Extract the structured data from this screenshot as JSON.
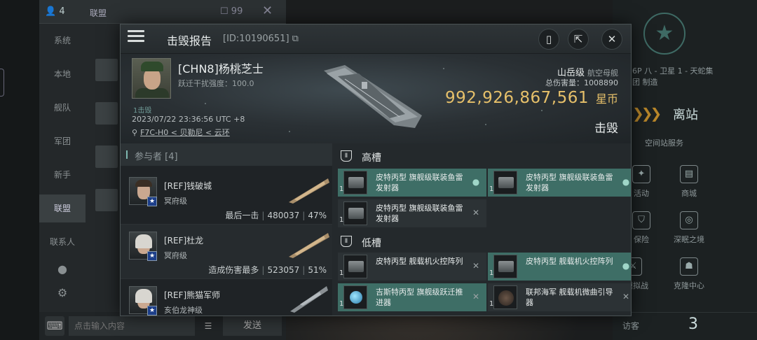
{
  "background": {
    "chat": {
      "member_count": "4",
      "channel_name": "联盟",
      "unread_count": "99",
      "channels": [
        "系统",
        "本地",
        "舰队",
        "军团",
        "新手",
        "联盟",
        "联系人"
      ],
      "active_channel": "联盟",
      "input_placeholder": "点击输入内容",
      "send_label": "发送"
    },
    "station": {
      "location_line1": "6P 八 - 卫星 1 - 天蛇集",
      "location_line2": "团 制造",
      "undock_label": "离站",
      "services_title": "空间站服务",
      "services": [
        {
          "label": "活动",
          "icon": "activity-icon"
        },
        {
          "label": "商城",
          "icon": "shop-icon"
        },
        {
          "label": "保险",
          "icon": "insurance-icon"
        },
        {
          "label": "深眠之境",
          "icon": "deep-sleep-icon"
        },
        {
          "label": "力模拟战",
          "icon": "simulation-icon"
        },
        {
          "label": "克隆中心",
          "icon": "clone-icon"
        }
      ],
      "visitor_label": "访客",
      "visitor_count": "3"
    }
  },
  "modal": {
    "title": "击毁报告",
    "id_text": "[ID:10190651]",
    "victim": {
      "name": "[CHN8]杨桃芝士",
      "sub": "跃迁干扰强度：100.0",
      "kill_tag": "1击毁",
      "time": "2023/07/22 23:36:56 UTC +8",
      "location": "F7C-H0 < 贝勒尼 < 云环"
    },
    "ship": {
      "name": "山岳级",
      "type": "航空母舰",
      "total_damage": "总伤害量：1008890",
      "isk_value": "992,926,867,561",
      "isk_unit": "星币",
      "status": "击毁"
    },
    "participants_header": "参与者 [4]",
    "participants": [
      {
        "name": "[REF]钱破城",
        "ship": "冥府级",
        "stat_label": "最后一击",
        "damage": "480037",
        "percent": "47%"
      },
      {
        "name": "[REF]杜龙",
        "ship": "冥府级",
        "stat_label": "造成伤害最多",
        "damage": "523057",
        "percent": "51%"
      },
      {
        "name": "[REF]熊猫军师",
        "ship": "亥伯龙神级",
        "stat_label": "",
        "damage": "",
        "percent": ""
      }
    ],
    "high_slot_label": "高槽",
    "low_slot_label": "低槽",
    "high_modules": [
      {
        "name": "皮特丙型 旗舰级联装鱼雷发射器",
        "qty": "1",
        "status": "dropped",
        "highlight": true
      },
      {
        "name": "皮特丙型 旗舰级联装鱼雷发射器",
        "qty": "1",
        "status": "dropped",
        "highlight": false
      },
      {
        "name": "皮特丙型 旗舰级联装鱼雷发射器",
        "qty": "1",
        "status": "destroyed",
        "highlight": false
      }
    ],
    "low_modules": [
      {
        "name": "皮特丙型 舰载机火控阵列",
        "qty": "1",
        "status": "destroyed",
        "highlight": false
      },
      {
        "name": "皮特丙型 舰载机火控阵列",
        "qty": "1",
        "status": "dropped",
        "highlight": true
      },
      {
        "name": "吉斯特丙型 旗舰级跃迁推进器",
        "qty": "1",
        "status": "destroyed",
        "highlight": true
      },
      {
        "name": "联邦海军 舰载机微曲引导器",
        "qty": "1",
        "status": "destroyed",
        "highlight": false
      }
    ]
  },
  "colors": {
    "accent_teal": "#3e6e66",
    "isk_gold": "#e6c06a"
  }
}
